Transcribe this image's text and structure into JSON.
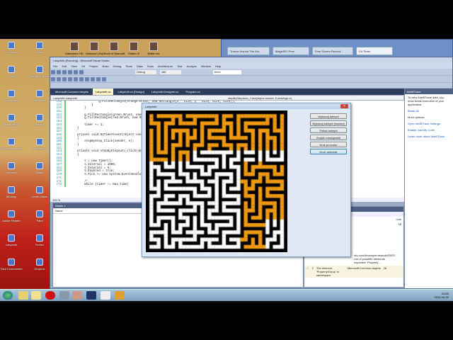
{
  "desktop": {
    "icons_left": [
      "Computer",
      "Opera",
      "Trash",
      "Google Chrome",
      "Shockwave",
      "NetBeans",
      "Visual Studio",
      "Eclipse",
      "VLC media player",
      "Notepad++",
      "Audacity",
      "Skype",
      "Winamp",
      "Game Maker",
      "Adobe Reader",
      "Paint",
      "Labyrinth",
      "Firefox",
      "Total Commander",
      "Dropbox"
    ],
    "icons_top": [
      "Halloween HD Wall.",
      "Hallows2 (2e)",
      "World of Warcraft",
      "Diablo III",
      "Battle.net"
    ]
  },
  "browser": {
    "tabs": [
      "Trance Around The Wo...",
      "MagicISO Free",
      "Free Screen Record...",
      "C# Timer"
    ]
  },
  "vs": {
    "title": "Labyrinth (Running) - Microsoft Visual Studio",
    "menu": [
      "File",
      "Edit",
      "View",
      "Git",
      "Project",
      "Build",
      "Debug",
      "Team",
      "Data",
      "Tools",
      "Architecture",
      "Test",
      "Analyze",
      "Window",
      "Help"
    ],
    "config": "Debug",
    "platform": "x86",
    "find_value": "timer",
    "doc_tabs": [
      "Microsoft.Common.targets",
      "Labyrinth.cs",
      "Labyrinth.cs [Design]",
      "Labyrinth.Designer.cs",
      "Program.cs"
    ],
    "nav_class": "Labyrinth.Labyrinth",
    "nav_member": "stepByStepAuto_Click(object sender, EventArgs e)",
    "code": [
      {
        "n": "148",
        "t": "                g.FillRectangle(orange.Brush, new Rectangle(x * size, y * size, size, size));"
      },
      {
        "n": "149",
        "t": "            }"
      },
      {
        "n": "150",
        "t": "        }"
      },
      {
        "n": "151",
        "t": ""
      },
      {
        "n": "152",
        "t": "        g.FillRectangle(green.Brush, new Rectangle(start.X * size, ..."
      },
      {
        "n": "153",
        "t": "        g.FillRectangle(red.Brush, new Rectangle(end.X * size, ..."
      },
      {
        "n": "154",
        "t": ""
      },
      {
        "n": "155",
        "t": "        timer += 1;"
      },
      {
        "n": "156",
        "t": "    }"
      },
      {
        "n": "157",
        "t": ""
      },
      {
        "n": "158",
        "t": "    private void OnTimerEvent(object sender, EventArgs e)"
      },
      {
        "n": "159",
        "t": "    {"
      },
      {
        "n": "160",
        "t": "        stepByStep_Click(sender, e);"
      },
      {
        "n": "161",
        "t": "    }"
      },
      {
        "n": "162",
        "t": ""
      },
      {
        "n": "163",
        "t": "    private void stepByStepAuto_Click(object sender, EventArgs e)"
      },
      {
        "n": "164",
        "t": "    {"
      },
      {
        "n": "165",
        "t": ""
      },
      {
        "n": "166",
        "t": "        t = new Timer();"
      },
      {
        "n": "167",
        "t": "        t.Interval = 1000;"
      },
      {
        "n": "168",
        "t": "        t.Interval = 5;"
      },
      {
        "n": "169",
        "t": "        t.Enabled = true;"
      },
      {
        "n": "170",
        "t": "        t.Tick += new System.EventHandler(OnTimerEvent);"
      },
      {
        "n": "171",
        "t": ""
      },
      {
        "n": "172",
        "t": "        /*"
      },
      {
        "n": "173",
        "t": "        while (timer != max_time)"
      }
    ],
    "zoom": "100 %",
    "watch": {
      "title": "Watch 1",
      "col_name": "Name"
    },
    "errors": {
      "messages_tab": "5 Messages",
      "col_file": "File",
      "col_line": "Line",
      "rows": [
        {
          "file": "Microsoft.Common.targets",
          "line": "28"
        },
        {
          "num": "2",
          "desc": "The element 'PropertyGroup' in namespace",
          "file": "Microsoft.Common.targets",
          "line": "28"
        }
      ],
      "fragment": "ofs.com/developer/msbuild/2003'. List of possible elements expected: 'Property'..."
    },
    "intellitrace": {
      "title": "IntelliTrace",
      "intro": "To view IntelliTrace data, you must break execution of your application.",
      "break_all": "Break All",
      "more": "More options:",
      "link1": "Open IntelliTrace Settings",
      "link2": "Enable Just My Code",
      "link3": "Learn more about IntelliTrace"
    }
  },
  "maze_form": {
    "title": "Labyrinth",
    "buttons": [
      "Wykonaj labirynt",
      "Wykonaj labirynt (losowo)",
      "Pokaż labirynt",
      "Znajdź rozwiązanie",
      "Krok po kroku",
      "Krok: automat"
    ],
    "colors": {
      "wall": "#000000",
      "path": "#ffffff",
      "visited": "#f09a10"
    }
  },
  "taskbar": {
    "time": "23:50",
    "date": "2012-04-22"
  }
}
